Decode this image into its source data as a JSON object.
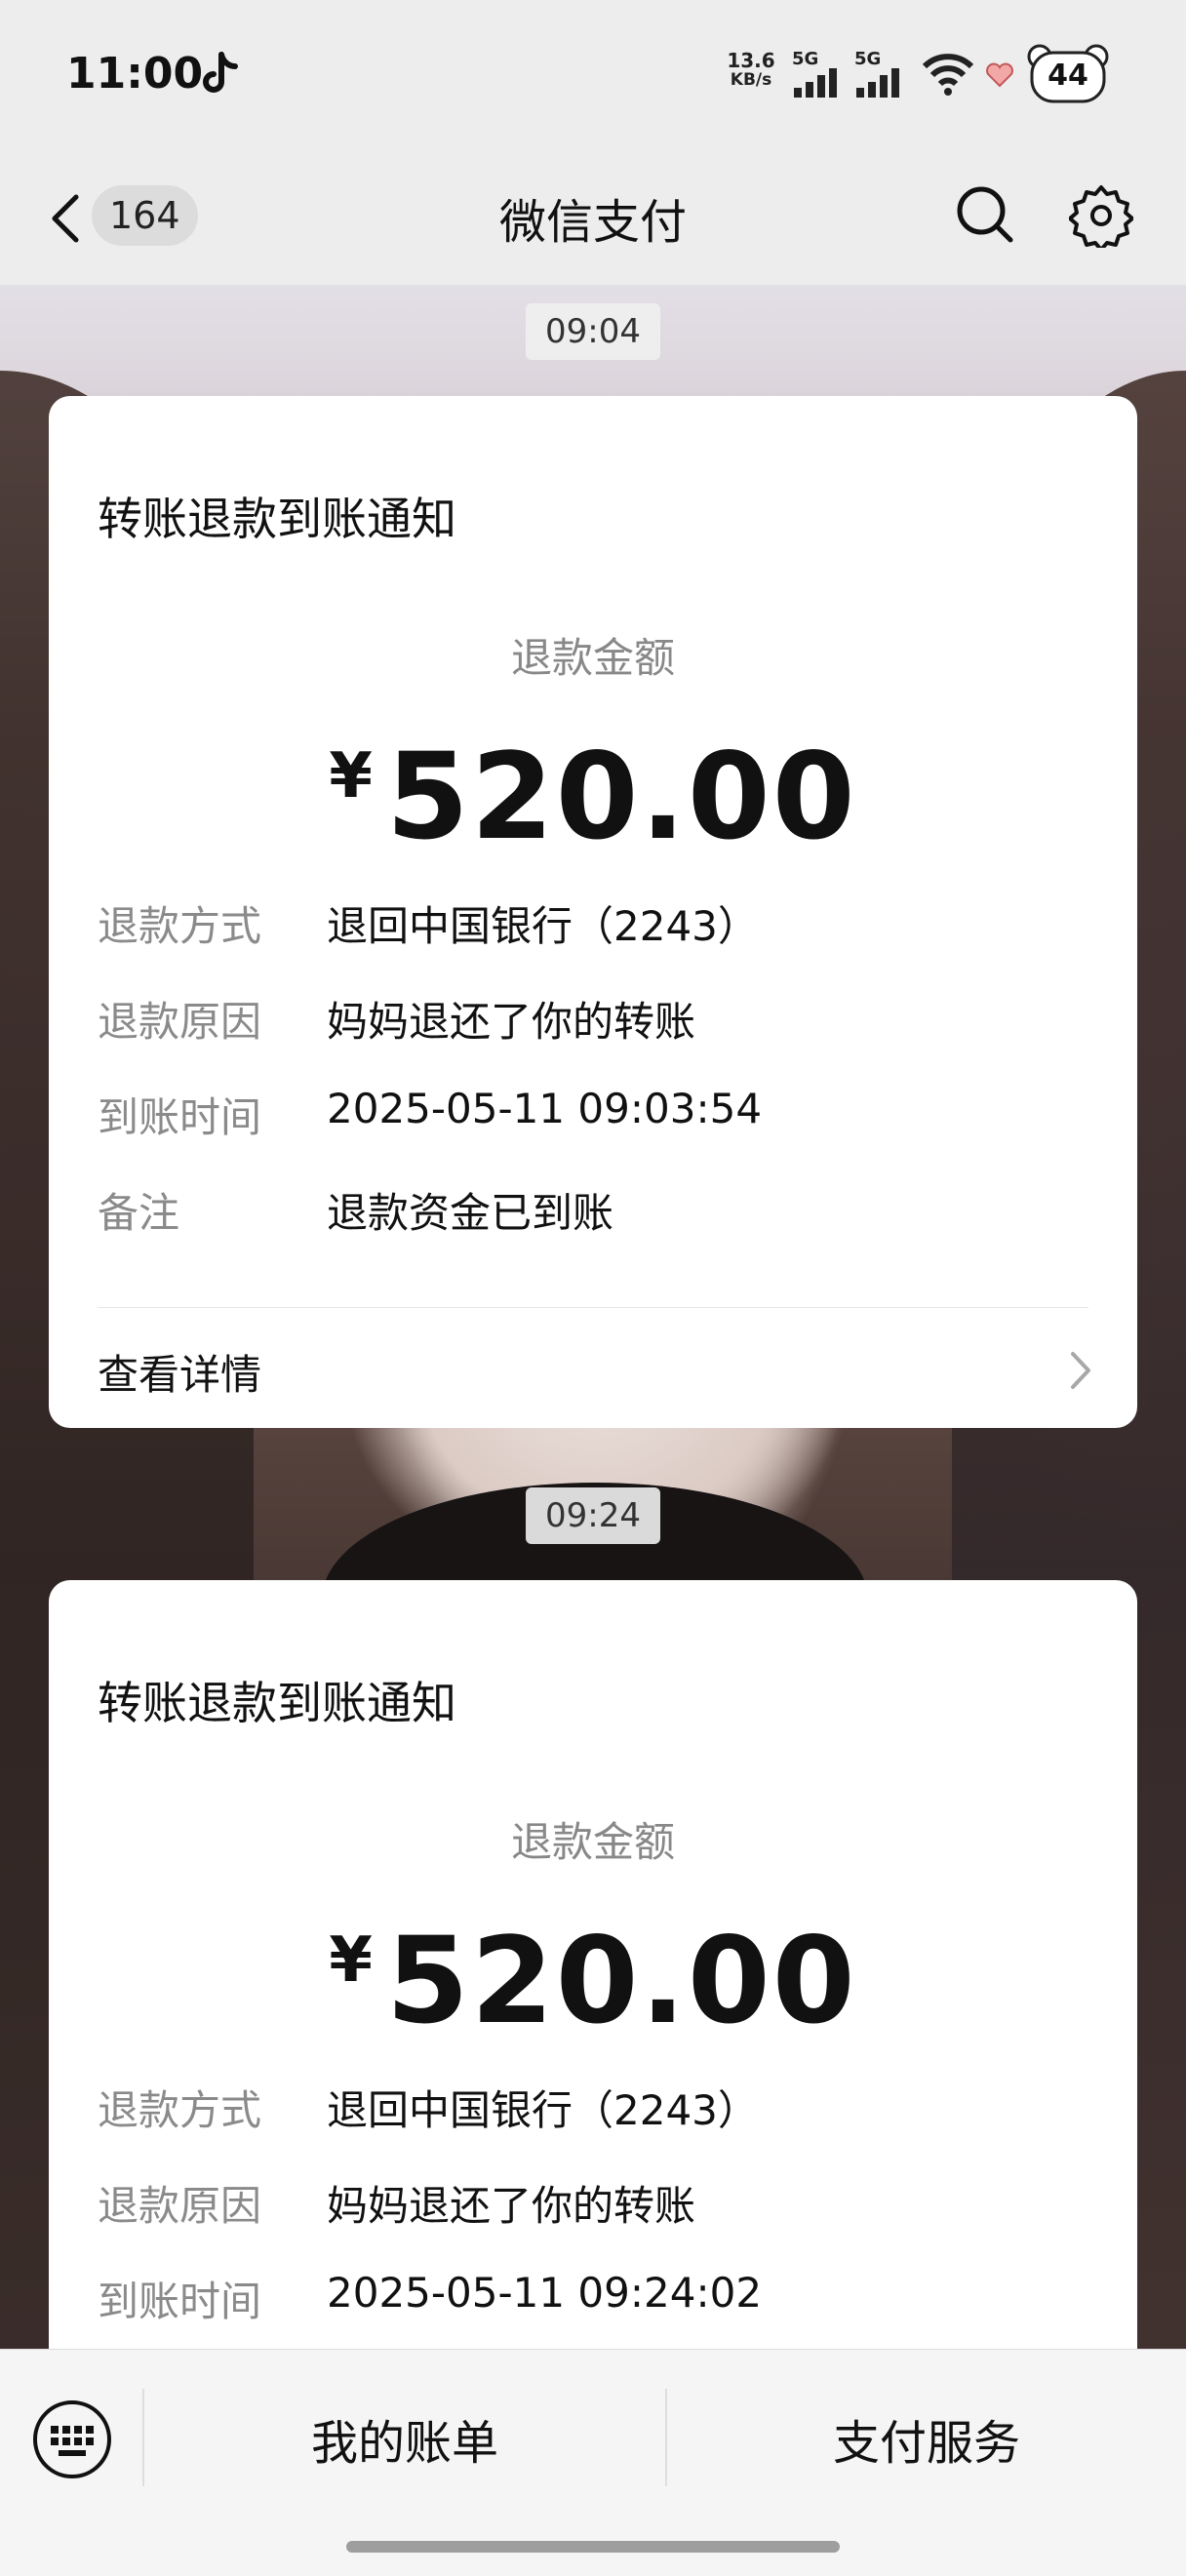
{
  "status": {
    "time": "11:00",
    "net_speed": "13.6",
    "net_unit": "KB/s",
    "sig1_label": "5G",
    "sig2_label": "5G",
    "battery": "44"
  },
  "nav": {
    "unread_count": "164",
    "title": "微信支付"
  },
  "messages": [
    {
      "time": "09:04",
      "title": "转账退款到账通知",
      "amount_label": "退款金额",
      "currency": "¥",
      "amount": "520.00",
      "rows": [
        {
          "label": "退款方式",
          "value": "退回中国银行（2243）"
        },
        {
          "label": "退款原因",
          "value": "妈妈退还了你的转账"
        },
        {
          "label": "到账时间",
          "value": "2025-05-11 09:03:54"
        },
        {
          "label": "备注",
          "value": "退款资金已到账"
        }
      ],
      "details_label": "查看详情"
    },
    {
      "time": "09:24",
      "title": "转账退款到账通知",
      "amount_label": "退款金额",
      "currency": "¥",
      "amount": "520.00",
      "rows": [
        {
          "label": "退款方式",
          "value": "退回中国银行（2243）"
        },
        {
          "label": "退款原因",
          "value": "妈妈退还了你的转账"
        },
        {
          "label": "到账时间",
          "value": "2025-05-11 09:24:02"
        }
      ]
    }
  ],
  "bottom": {
    "menu1": "我的账单",
    "menu2": "支付服务"
  }
}
